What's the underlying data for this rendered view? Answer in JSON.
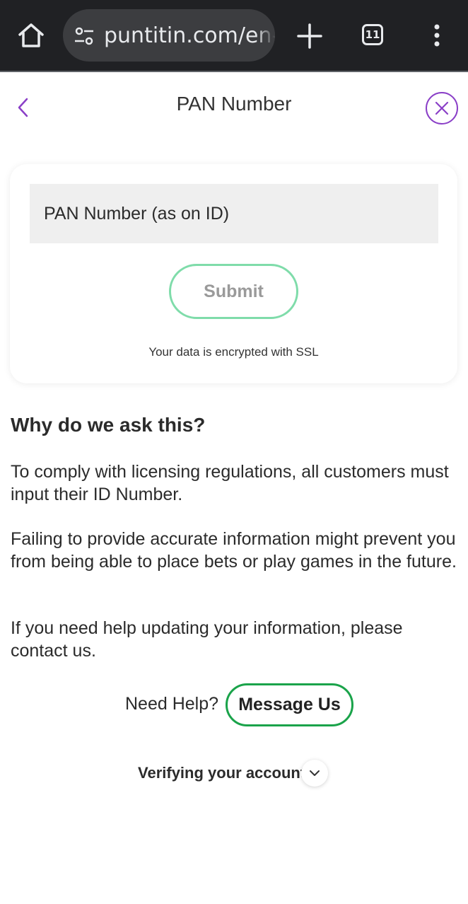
{
  "browser": {
    "url": "puntitin.com/en-in",
    "tab_count": "11"
  },
  "header": {
    "title": "PAN Number"
  },
  "form": {
    "pan_placeholder": "PAN Number (as on ID)",
    "submit_label": "Submit",
    "ssl_note": "Your data is encrypted with SSL"
  },
  "info": {
    "heading": "Why do we ask this?",
    "paragraphs": [
      "To comply with licensing regulations, all customers must input their ID Number.",
      "Failing to provide accurate information might prevent you from being able to place bets or play games in the future.",
      "If you need help updating your information, please contact us."
    ]
  },
  "help": {
    "need_help_label": "Need Help?",
    "message_button_label": "Message Us"
  },
  "verify": {
    "label": "Verifying your account"
  },
  "colors": {
    "accent_purple": "#8a3fc7",
    "submit_border": "#7fdcaa",
    "message_border": "#1aa34a",
    "browser_bg": "#202124"
  }
}
